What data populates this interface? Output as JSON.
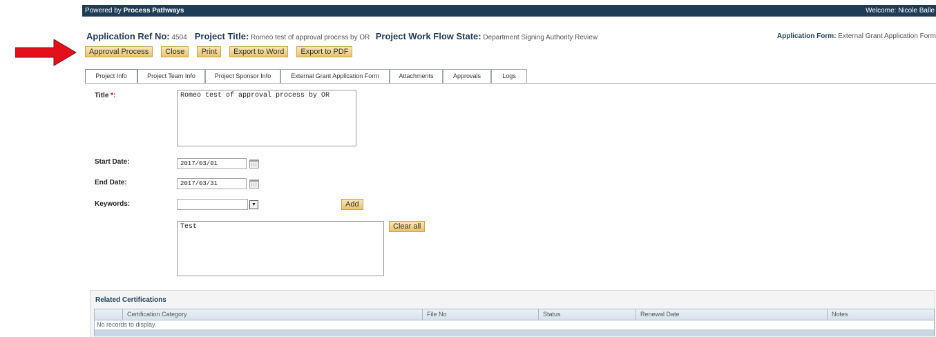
{
  "topbar": {
    "powered_prefix": "Powered by",
    "brand": "Process Pathways",
    "welcome": "Welcome: Nicole Balle"
  },
  "header": {
    "app_ref_label": "Application Ref No:",
    "app_ref_value": "4504",
    "project_title_label": "Project Title:",
    "project_title_value": "Romeo test of approval process by OR",
    "workflow_label": "Project Work Flow State:",
    "workflow_value": "Department Signing Authority Review",
    "app_form_label": "Application Form:",
    "app_form_value": "External Grant Application Form"
  },
  "toolbar": {
    "approval_process": "Approval Process",
    "close": "Close",
    "print": "Print",
    "export_word": "Export to Word",
    "export_pdf": "Export to PDF"
  },
  "tabs": [
    {
      "label": "Project Info",
      "active": true
    },
    {
      "label": "Project Team Info"
    },
    {
      "label": "Project Sponsor Info"
    },
    {
      "label": "External Grant Application Form"
    },
    {
      "label": "Attachments"
    },
    {
      "label": "Approvals"
    },
    {
      "label": "Logs"
    }
  ],
  "form": {
    "title_label": "Title",
    "title_required": "*:",
    "title_value": "Romeo test of approval process by OR",
    "start_date_label": "Start Date:",
    "start_date_value": "2017/03/01",
    "end_date_label": "End Date:",
    "end_date_value": "2017/03/31",
    "keywords_label": "Keywords:",
    "keywords_value": "",
    "add_button": "Add",
    "keywords_list": "Test",
    "clear_all_button": "Clear all"
  },
  "certifications": {
    "section_title": "Related Certifications",
    "columns": [
      "Certification Category",
      "File No",
      "Status",
      "Renewal Date",
      "Notes"
    ],
    "empty_message": "No records to display."
  },
  "colors": {
    "topbar_bg": "#1f3c57",
    "button_gradient_top": "#fbe7b3",
    "button_gradient_bottom": "#e9c36d",
    "arrow": "#e3101b"
  }
}
